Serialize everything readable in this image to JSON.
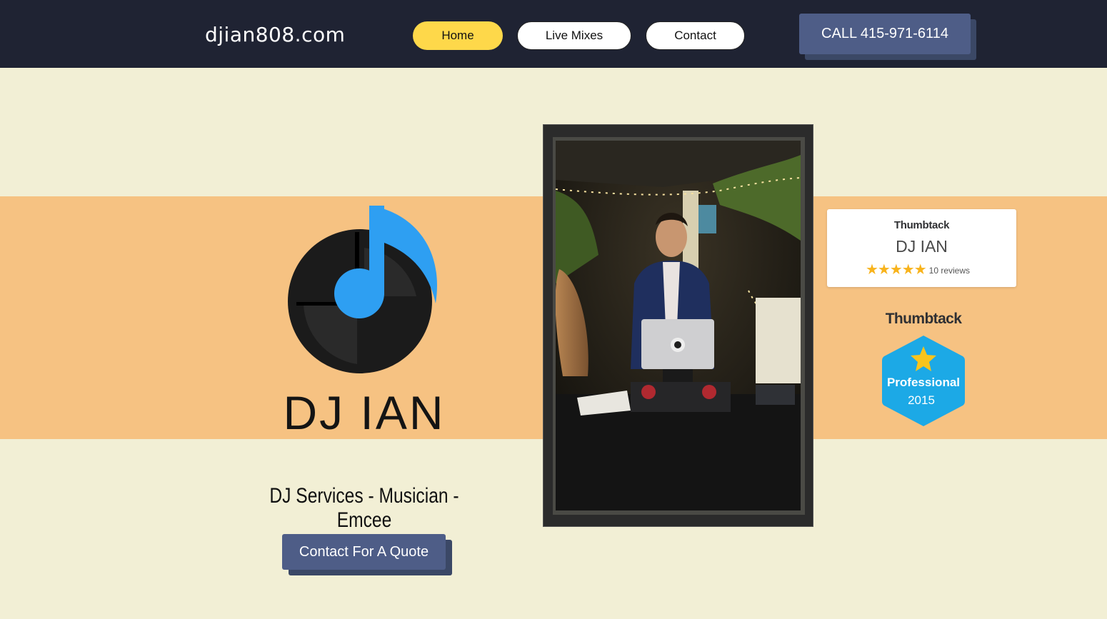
{
  "header": {
    "site_title": "djian808.com",
    "nav": {
      "home": "Home",
      "live_mixes": "Live Mixes",
      "contact": "Contact"
    },
    "call_button": "CALL 415-971-6114"
  },
  "hero": {
    "logo_text": "DJ IAN",
    "tagline": "DJ Services - Musician - Emcee",
    "quote_button": "Contact For A Quote"
  },
  "thumbtack_card": {
    "brand": "Thumbtack",
    "name": "DJ IAN",
    "stars": "★★★★★",
    "rating": 5,
    "reviews": "10 reviews"
  },
  "thumbtack_badge": {
    "brand": "Thumbtack",
    "title": "Professional",
    "year": "2015"
  },
  "colors": {
    "header_bg": "#1f2333",
    "page_bg": "#f2efd5",
    "band": "#f6c282",
    "accent_yellow": "#fed84a",
    "button_blue": "#4e5d87",
    "logo_note_blue": "#2e9ff2",
    "badge_blue": "#1ca9e6",
    "star_gold": "#f8b31c"
  }
}
